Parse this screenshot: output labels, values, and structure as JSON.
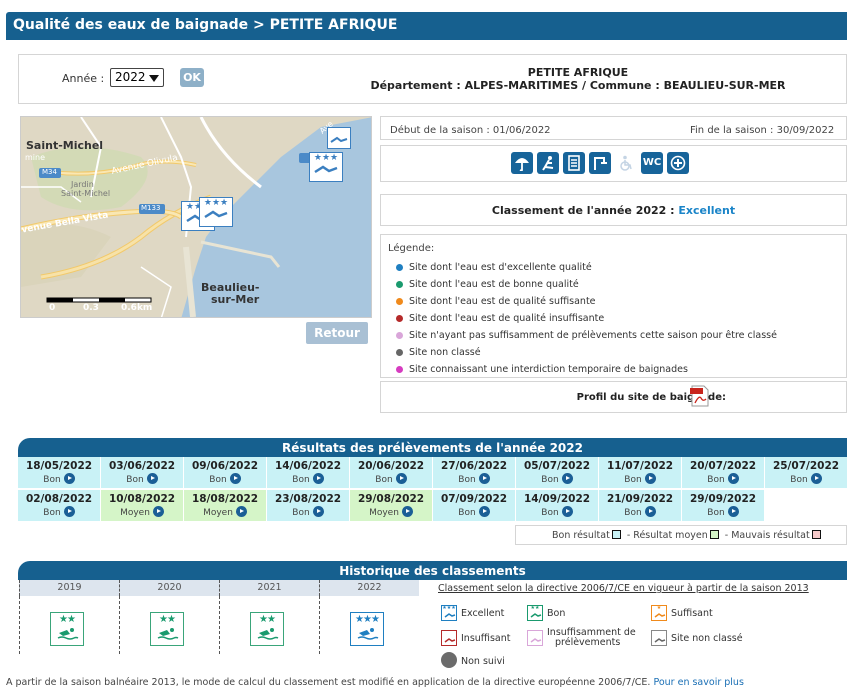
{
  "title": "Qualité des eaux de baignade > PETITE AFRIQUE",
  "header": {
    "year_label": "Année :",
    "year_value": "2022",
    "ok_label": "OK",
    "site_name": "PETITE AFRIQUE",
    "site_location": "Département : ALPES-MARITIMES   /   Commune : BEAULIEU-SUR-MER"
  },
  "map": {
    "labels": [
      "Saint-Michel",
      "mine",
      "Avenue Olivula",
      "M34",
      "Jardin",
      "Saint-Michel",
      "M133",
      "venue Bella Vista",
      "Beaulieu-",
      "sur-Mer",
      "Ave"
    ],
    "scale": [
      "0",
      "0.3",
      "0.6km"
    ],
    "back_label": "Retour"
  },
  "season": {
    "start": "Début de la saison :  01/06/2022",
    "end": "Fin de la saison :  30/09/2022"
  },
  "facilities": [
    {
      "name": "umbrella-icon",
      "enabled": true
    },
    {
      "name": "lifeguard-icon",
      "enabled": true
    },
    {
      "name": "info-board-icon",
      "enabled": true
    },
    {
      "name": "shower-icon",
      "enabled": true
    },
    {
      "name": "wheelchair-icon",
      "enabled": false
    },
    {
      "name": "wc-icon",
      "enabled": true,
      "text": "WC"
    },
    {
      "name": "first-aid-icon",
      "enabled": true
    }
  ],
  "ranking": {
    "label": "Classement de l'année 2022 : ",
    "value": "Excellent"
  },
  "legend": {
    "title": "Légende:",
    "items": [
      {
        "text": "Site dont l'eau est d'excellente qualité",
        "color": "#1f7fc1"
      },
      {
        "text": "Site dont l'eau est de bonne qualité",
        "color": "#1a9a6e"
      },
      {
        "text": "Site dont l'eau est de qualité suffisante",
        "color": "#f08a1c"
      },
      {
        "text": "Site dont l'eau est de qualité insuffisante",
        "color": "#b52a2a"
      },
      {
        "text": "Site n'ayant pas suffisamment de prélèvements cette saison pour être classé",
        "color": "#d9a6d9"
      },
      {
        "text": "Site non classé",
        "color": "#666666"
      },
      {
        "text": "Site connaissant une interdiction temporaire de baignades",
        "color": "#d63cc0"
      }
    ]
  },
  "profile_label": "Profil du site de baignade:",
  "results": {
    "title": "Résultats des prélèvements de l'année 2022",
    "rows": [
      [
        {
          "date": "18/05/2022",
          "result": "Bon",
          "level": "good"
        },
        {
          "date": "03/06/2022",
          "result": "Bon",
          "level": "good"
        },
        {
          "date": "09/06/2022",
          "result": "Bon",
          "level": "good"
        },
        {
          "date": "14/06/2022",
          "result": "Bon",
          "level": "good"
        },
        {
          "date": "20/06/2022",
          "result": "Bon",
          "level": "good"
        },
        {
          "date": "27/06/2022",
          "result": "Bon",
          "level": "good"
        },
        {
          "date": "05/07/2022",
          "result": "Bon",
          "level": "good"
        },
        {
          "date": "11/07/2022",
          "result": "Bon",
          "level": "good"
        },
        {
          "date": "20/07/2022",
          "result": "Bon",
          "level": "good"
        },
        {
          "date": "25/07/2022",
          "result": "Bon",
          "level": "good"
        }
      ],
      [
        {
          "date": "02/08/2022",
          "result": "Bon",
          "level": "good"
        },
        {
          "date": "10/08/2022",
          "result": "Moyen",
          "level": "medium"
        },
        {
          "date": "18/08/2022",
          "result": "Moyen",
          "level": "medium"
        },
        {
          "date": "23/08/2022",
          "result": "Bon",
          "level": "good"
        },
        {
          "date": "29/08/2022",
          "result": "Moyen",
          "level": "medium"
        },
        {
          "date": "07/09/2022",
          "result": "Bon",
          "level": "good"
        },
        {
          "date": "14/09/2022",
          "result": "Bon",
          "level": "good"
        },
        {
          "date": "21/09/2022",
          "result": "Bon",
          "level": "good"
        },
        {
          "date": "29/09/2022",
          "result": "Bon",
          "level": "good"
        },
        {
          "date": "",
          "result": "",
          "level": "empty"
        }
      ]
    ],
    "legend": {
      "good": "Bon résultat",
      "sep": " - ",
      "medium": "Résultat moyen",
      "bad": "Mauvais résultat",
      "good_color": "#c9f2f6",
      "medium_color": "#d5f5c8",
      "bad_color": "#f6c9c9"
    }
  },
  "history": {
    "title": "Historique des classements",
    "years": [
      {
        "year": "2019",
        "stars": "★★"
      },
      {
        "year": "2020",
        "stars": "★★"
      },
      {
        "year": "2021",
        "stars": "★★"
      },
      {
        "year": "2022",
        "stars": "★★★"
      }
    ],
    "directive": "Classement selon la directive 2006/7/CE en vigueur à partir de la saison 2013",
    "legend": {
      "excellent": "Excellent",
      "good": "Bon",
      "sufficient": "Suffisant",
      "insufficient": "Insuffisant",
      "not_enough_1": "Insuffisamment de",
      "not_enough_2": "prélèvements",
      "unranked": "Site non classé",
      "not_followed": "Non suivi"
    }
  },
  "note": {
    "text": "A partir de la saison balnéaire 2013, le mode de calcul du classement est modifié en application de la directive européenne 2006/7/CE. ",
    "link": "Pour en savoir plus"
  }
}
